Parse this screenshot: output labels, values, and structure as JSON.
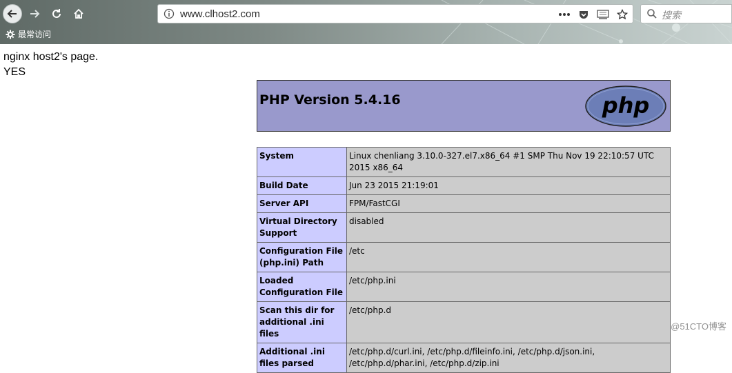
{
  "browser": {
    "url": "www.clhost2.com",
    "search_placeholder": "搜索",
    "bookmark_label": "最常访问"
  },
  "page": {
    "line1": "nginx host2's page.",
    "line2": "YES"
  },
  "php": {
    "version_title": "PHP Version 5.4.16",
    "logo_text": "php"
  },
  "table": {
    "rows": [
      {
        "key": "System",
        "value": "Linux chenliang 3.10.0-327.el7.x86_64 #1 SMP Thu Nov 19 22:10:57 UTC 2015 x86_64"
      },
      {
        "key": "Build Date",
        "value": "Jun 23 2015 21:19:01"
      },
      {
        "key": "Server API",
        "value": "FPM/FastCGI"
      },
      {
        "key": "Virtual Directory Support",
        "value": "disabled"
      },
      {
        "key": "Configuration File (php.ini) Path",
        "value": "/etc"
      },
      {
        "key": "Loaded Configuration File",
        "value": "/etc/php.ini"
      },
      {
        "key": "Scan this dir for additional .ini files",
        "value": "/etc/php.d"
      },
      {
        "key": "Additional .ini files parsed",
        "value": "/etc/php.d/curl.ini, /etc/php.d/fileinfo.ini, /etc/php.d/json.ini, /etc/php.d/phar.ini, /etc/php.d/zip.ini"
      }
    ]
  },
  "watermark": "@51CTO博客",
  "colors": {
    "php_header": "#9999cc",
    "key_cell": "#ccccff",
    "value_cell": "#cccccc"
  }
}
